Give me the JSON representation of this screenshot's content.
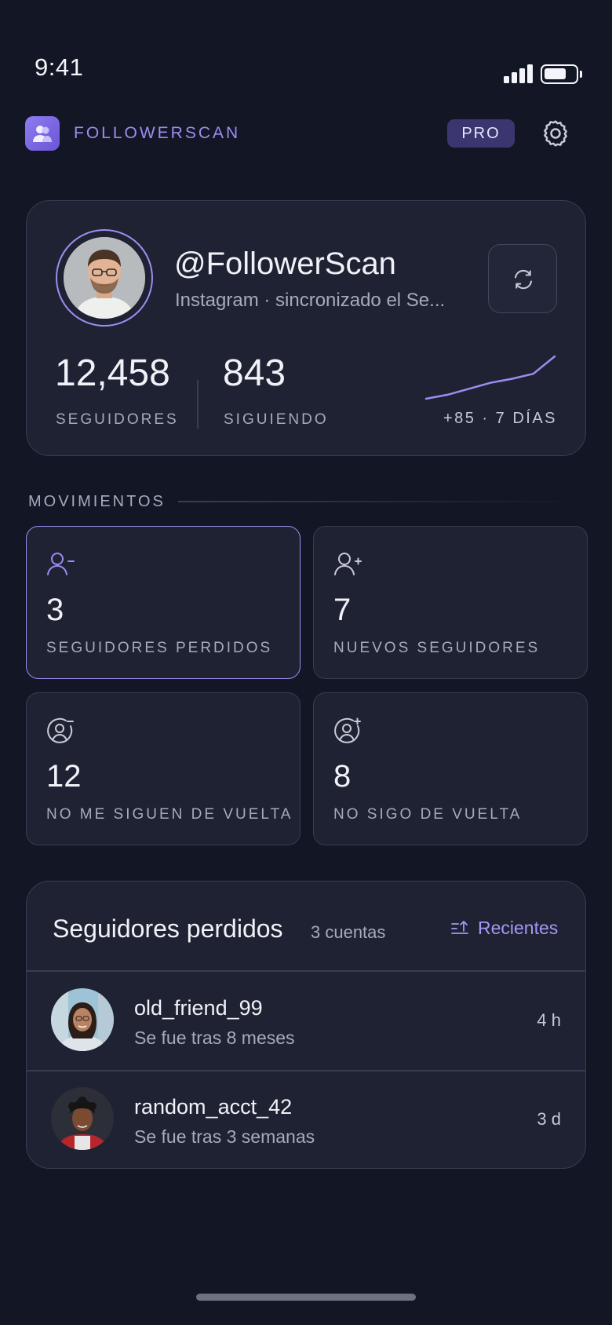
{
  "status_bar": {
    "time": "9:41",
    "battery_level": 0.7
  },
  "header": {
    "app_name": "FOLLOWERSCAN",
    "badge": "PRO",
    "settings_icon": "gear-icon",
    "logo_icon": "users-icon"
  },
  "profile": {
    "handle": "@FollowerScan",
    "sync_text": "Instagram · sincronizado el Se...",
    "followers_value": "12,458",
    "followers_label": "SEGUIDORES",
    "following_value": "843",
    "following_label": "SIGUIENDO",
    "trend_text": "+85 · 7 DÍAS",
    "refresh_icon": "refresh-icon",
    "accent": "#9b8ef0"
  },
  "sparkline": {
    "values": [
      12400,
      12408,
      12420,
      12432,
      12440,
      12450,
      12485
    ]
  },
  "movements": {
    "title": "MOVIMIENTOS",
    "tiles": [
      {
        "value": "3",
        "label": "SEGUIDORES PERDIDOS",
        "icon": "user-minus-icon",
        "active": true
      },
      {
        "value": "7",
        "label": "NUEVOS SEGUIDORES",
        "icon": "user-plus-icon",
        "active": false
      },
      {
        "value": "12",
        "label": "NO ME SIGUEN DE VUELTA",
        "icon": "user-circle-minus-icon",
        "active": false
      },
      {
        "value": "8",
        "label": "NO SIGO DE VUELTA",
        "icon": "user-circle-plus-icon",
        "active": false
      }
    ]
  },
  "lost_list": {
    "title": "Seguidores perdidos",
    "count": "3 cuentas",
    "sort_label": "Recientes",
    "sort_icon": "sort-icon",
    "items": [
      {
        "name": "old_friend_99",
        "subtitle": "Se fue tras 8 meses",
        "time": "4 h"
      },
      {
        "name": "random_acct_42",
        "subtitle": "Se fue tras 3 semanas",
        "time": "3 d"
      }
    ]
  }
}
